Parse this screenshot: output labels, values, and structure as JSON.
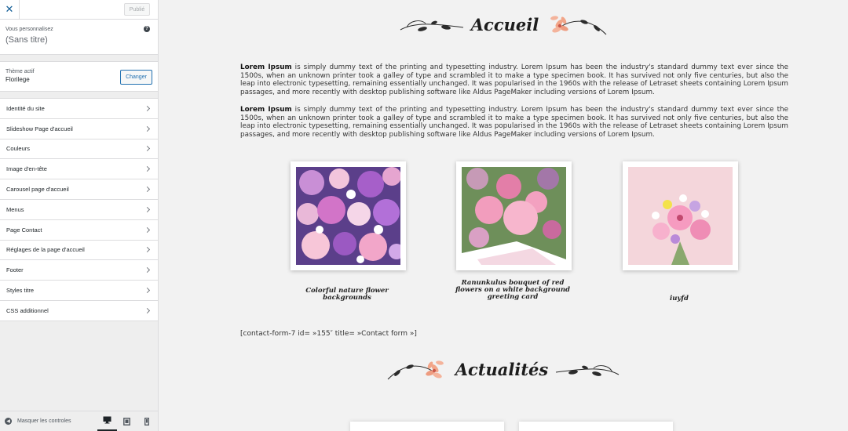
{
  "sidebar": {
    "close_icon": "close-icon",
    "publish_label": "Publié",
    "customizing_label": "Vous personnalisez",
    "customizing_title": "(Sans titre)",
    "help_icon": "help-icon",
    "active_theme_label": "Thème actif",
    "active_theme_name": "Florilege",
    "change_label": "Changer",
    "sections": [
      {
        "label": "Identité du site"
      },
      {
        "label": "Slideshow Page d'accueil"
      },
      {
        "label": "Couleurs"
      },
      {
        "label": "Image d'en-tête"
      },
      {
        "label": "Carousel page d'accueil"
      },
      {
        "label": "Menus"
      },
      {
        "label": "Page Contact"
      },
      {
        "label": "Réglages de la page d'accueil"
      },
      {
        "label": "Footer"
      },
      {
        "label": "Styles titre"
      },
      {
        "label": "CSS additionnel"
      }
    ],
    "footer": {
      "hide_controls_label": "Masquer les controles",
      "devices": [
        "desktop-icon",
        "tablet-icon",
        "mobile-icon"
      ]
    }
  },
  "preview": {
    "accueil_title": "Accueil",
    "paragraphs": [
      {
        "lead": "Lorem Ipsum",
        "text": " is simply dummy text of the printing and typesetting industry. Lorem Ipsum has been the industry's standard dummy text ever since the 1500s, when an unknown printer took a galley of type and scrambled it to make a type specimen book. It has survived not only five centuries, but also the leap into electronic typesetting, remaining essentially unchanged. It was popularised in the 1960s with the release of Letraset sheets containing Lorem Ipsum passages, and more recently with desktop publishing software like Aldus PageMaker including versions of Lorem Ipsum."
      },
      {
        "lead": "Lorem Ipsum",
        "text": " is simply dummy text of the printing and typesetting industry. Lorem Ipsum has been the industry's standard dummy text ever since the 1500s, when an unknown printer took a galley of type and scrambled it to make a type specimen book. It has survived not only five centuries, but also the leap into electronic typesetting, remaining essentially unchanged. It was popularised in the 1960s with the release of Letraset sheets containing Lorem Ipsum passages, and more recently with desktop publishing software like Aldus PageMaker including versions of Lorem Ipsum."
      }
    ],
    "gallery": [
      {
        "caption": "Colorful nature flower backgrounds"
      },
      {
        "caption": "Ranunkulus bouquet of red flowers on a white background greeting card"
      },
      {
        "caption": "iuyfd"
      }
    ],
    "shortcode": "[contact-form-7 id= »155″ title= »Contact form »]",
    "actualites_title": "Actualités",
    "colors": {
      "accent_flower": "#f2a588",
      "ornament": "#2b2b2b"
    }
  }
}
